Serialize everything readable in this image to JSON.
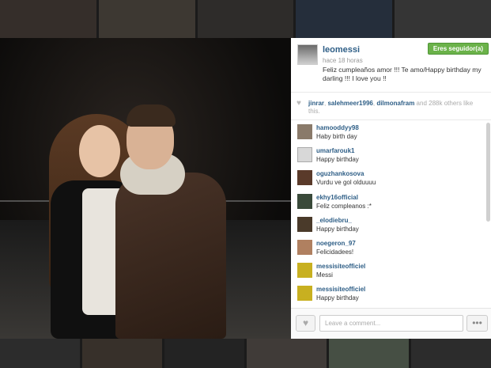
{
  "post": {
    "username": "leomessi",
    "follow_label": "Eres seguidor(a)",
    "time": "hace 18 horas",
    "caption": "Feliz cumpleaños amor !!! Te amo/Happy birthday my darling !!! I love you !!"
  },
  "likes": {
    "liker1": "jinrar",
    "liker2": "salehmeer1996",
    "liker3": "dilmonafram",
    "and": " and ",
    "count": "288k",
    "suffix": " others like this."
  },
  "comments": [
    {
      "user": "hamooddyy98",
      "text": "Haby birth day"
    },
    {
      "user": "umarfarouk1",
      "text": "Happy birthday"
    },
    {
      "user": "oguzhankosova",
      "text": "Vurdu ve gol olduuuu"
    },
    {
      "user": "ekhy16official",
      "text": "Feliz compleanos :*"
    },
    {
      "user": "_elodiebru_",
      "text": "Happy birthday"
    },
    {
      "user": "noegeron_97",
      "text": "Felicidadees!"
    },
    {
      "user": "messisiteofficiel",
      "text": "Messi"
    },
    {
      "user": "messisiteofficiel",
      "text": "Happy birthday"
    }
  ],
  "footer": {
    "comment_placeholder": "Leave a comment...",
    "more_label": "•••"
  },
  "icons": {
    "heart": "heart-icon",
    "more": "more-icon"
  },
  "colors": {
    "username": "#2e5e86",
    "follow_button": "#6bb24a"
  }
}
